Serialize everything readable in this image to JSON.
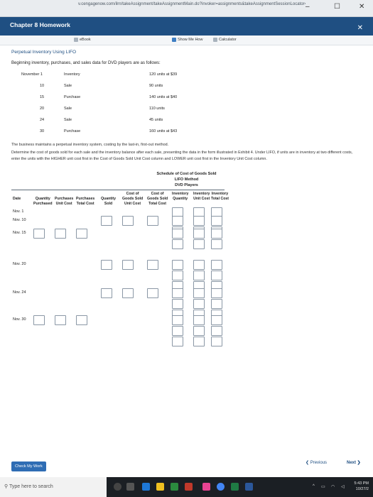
{
  "browser": {
    "url": "v.cengagenow.com/ilrn/takeAssignment/takeAssignmentMain.do?invoker=assignments&takeAssignmentSessionLocator=assignment-take&inprogress=false",
    "minimize_label": "–",
    "maximize_label": "☐",
    "close_label": "✕"
  },
  "app": {
    "title": "Chapter 8 Homework",
    "close_label": "✕"
  },
  "toolbar": {
    "ebook": "eBook",
    "show_me_how": "Show Me How",
    "calculator": "Calculator"
  },
  "problem": {
    "title": "Perpetual Inventory Using LIFO",
    "intro": "Beginning inventory, purchases, and sales data for DVD players are as follows:",
    "rows": [
      {
        "date": "November 1",
        "type": "Inventory",
        "detail": "120 units at $39"
      },
      {
        "date": "10",
        "type": "Sale",
        "detail": "90 units"
      },
      {
        "date": "15",
        "type": "Purchase",
        "detail": "140 units at $40"
      },
      {
        "date": "20",
        "type": "Sale",
        "detail": "110 units"
      },
      {
        "date": "24",
        "type": "Sale",
        "detail": "45 units"
      },
      {
        "date": "30",
        "type": "Purchase",
        "detail": "160 units at $43"
      }
    ],
    "instructions_1": "The business maintains a perpetual inventory system, costing by the last-in, first-out method.",
    "instructions_2": "Determine the cost of goods sold for each sale and the inventory balance after each sale, presenting the data in the form illustrated in Exhibit 4. Under LIFO, if units are in inventory at two different costs, enter the units with the HIGHER unit cost first in the Cost of Goods Sold Unit Cost column and LOWER unit cost first in the Inventory Unit Cost column."
  },
  "schedule": {
    "title": "Schedule of Cost of Goods Sold",
    "method": "LIFO Method",
    "product": "DVD Players",
    "headers": [
      "Date",
      "Quantity\nPurchased",
      "Purchases\nUnit Cost",
      "Purchases\nTotal Cost",
      "Quantity\nSold",
      "Cost of\nGoods Sold\nUnit Cost",
      "Cost of\nGoods Sold\nTotal Cost",
      "Inventory\nQuantity",
      "Inventory\nUnit Cost",
      "Inventory\nTotal Cost"
    ],
    "dates": [
      "Nov. 1",
      "Nov. 10",
      "Nov. 15",
      "Nov. 20",
      "Nov. 24",
      "Nov. 30"
    ]
  },
  "footer": {
    "check_label": "Check My Work",
    "previous_label": "❮ Previous",
    "next_label": "Next ❯"
  },
  "taskbar": {
    "search_placeholder": "Type here to search",
    "time": "5:43 PM",
    "date": "10/27/2"
  }
}
